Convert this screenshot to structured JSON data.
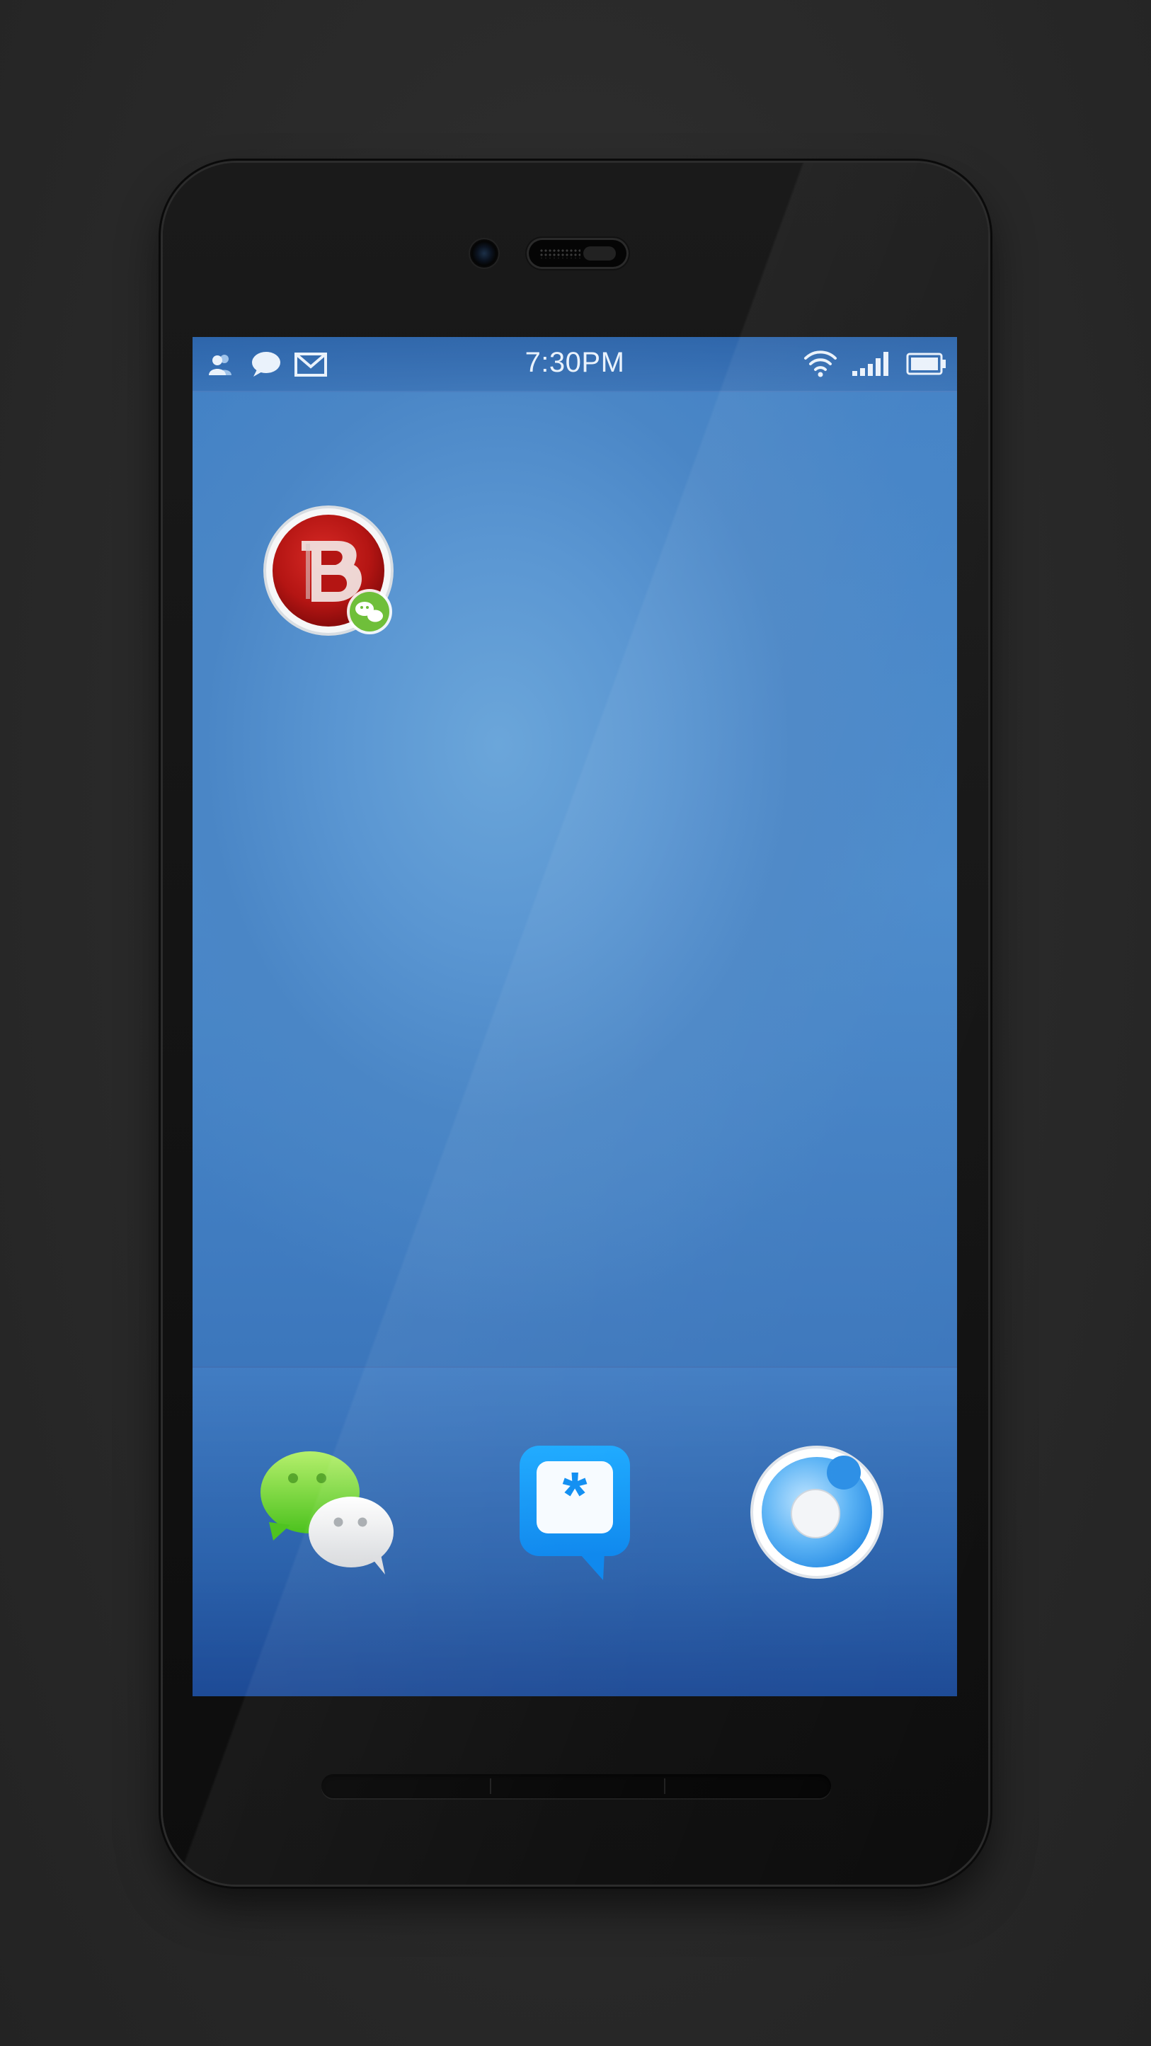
{
  "status_bar": {
    "time": "7:30PM",
    "left_icons": [
      "contacts-icon",
      "message-bubble-icon",
      "mail-icon"
    ],
    "right_icons": [
      "wifi-icon",
      "signal-icon",
      "battery-icon"
    ]
  },
  "desktop": {
    "apps": [
      {
        "name": "b-app",
        "icon": "red-circle-b-icon",
        "badge": "wechat-badge-icon"
      }
    ]
  },
  "dock": {
    "apps": [
      {
        "name": "wechat",
        "icon": "wechat-chat-bubbles-icon"
      },
      {
        "name": "asterisk-chat",
        "icon": "asterisk-speech-bubble-icon"
      },
      {
        "name": "circle-app",
        "icon": "blue-ring-icon"
      }
    ]
  },
  "colors": {
    "wallpaper_light": "#6ba6da",
    "wallpaper_dark": "#2c5fa6",
    "phone_body": "#111111",
    "background": "#2a2a2a"
  }
}
